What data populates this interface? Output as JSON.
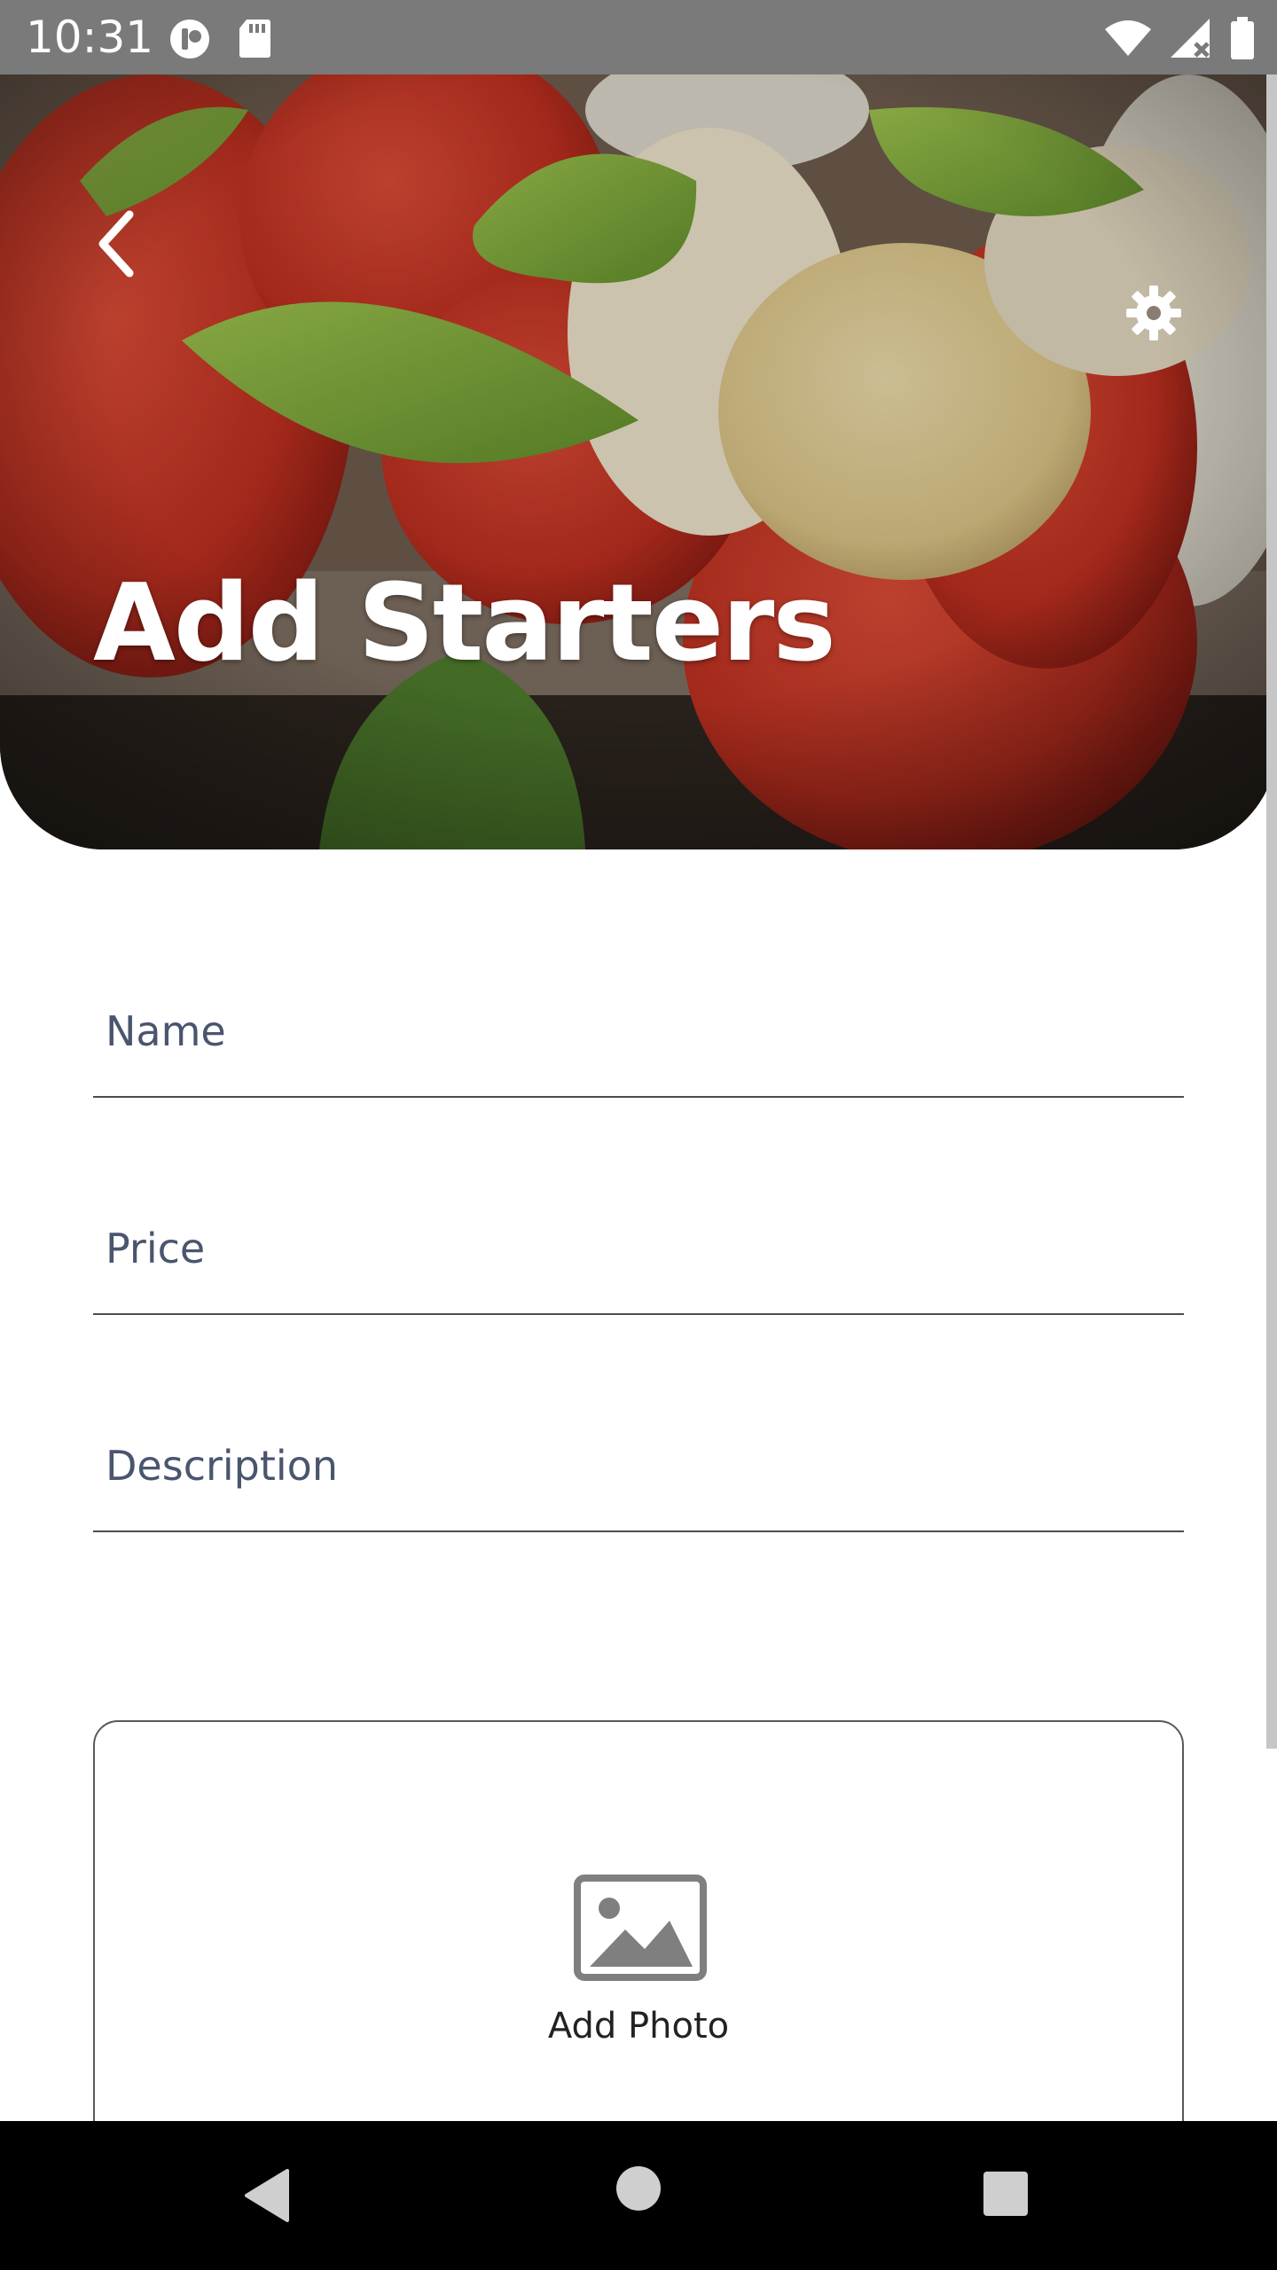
{
  "status_bar": {
    "time": "10:31",
    "left_icons": [
      "vpn-key-icon",
      "sd-card-icon"
    ],
    "right_icons": [
      "wifi-icon",
      "signal-icon",
      "battery-icon"
    ]
  },
  "header": {
    "title": "Add Starters",
    "back_icon": "chevron-left-icon",
    "settings_icon": "gear-icon",
    "background_image": "caprese salad with tomato, mozzarella and basil"
  },
  "form": {
    "name_placeholder": "Name",
    "price_placeholder": "Price",
    "description_placeholder": "Description",
    "photo_label": "Add Photo",
    "photo_icon": "image-icon"
  },
  "nav_bar": {
    "buttons": [
      "back-triangle-icon",
      "home-circle-icon",
      "recents-square-icon"
    ]
  },
  "colors": {
    "status_bar": "#7a7a7a",
    "placeholder": "#4a556e",
    "divider": "#4d4d4d",
    "nav_bar": "#000000"
  }
}
